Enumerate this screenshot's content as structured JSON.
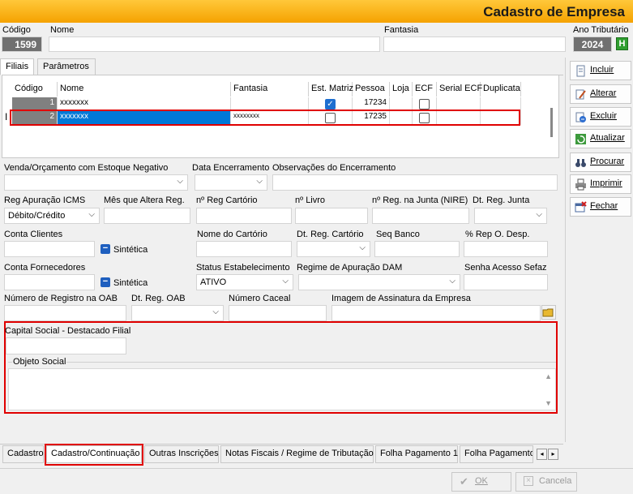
{
  "window": {
    "title": "Cadastro de Empresa"
  },
  "header": {
    "codigo_label": "Código",
    "codigo_value": "1599",
    "nome_label": "Nome",
    "fantasia_label": "Fantasia",
    "ano_label": "Ano Tributário",
    "ano_value": "2024",
    "ano_btn": "H"
  },
  "top_tabs": [
    "Filiais",
    "Parâmetros"
  ],
  "grid": {
    "columns": [
      "Código",
      "Nome",
      "Fantasia",
      "Est. Matriz",
      "Pessoa",
      "Loja",
      "ECF",
      "Serial ECF",
      "Duplicata"
    ],
    "rows": [
      {
        "codigo": "1",
        "nome": "xxxxxxx",
        "fantasia": "",
        "matriz": true,
        "pessoa": "17234",
        "ecf": false
      },
      {
        "codigo": "2",
        "nome": "xxxxxxx",
        "fantasia": "xxxxxxxx",
        "matriz": false,
        "pessoa": "17235",
        "ecf": false
      }
    ],
    "row_marker": "I"
  },
  "form": {
    "venda_label": "Venda/Orçamento com Estoque Negativo",
    "data_enc_label": "Data Encerramento",
    "obs_enc_label": "Observações do Encerramento",
    "reg_icms_label": "Reg Apuração ICMS",
    "reg_icms_value": "Débito/Crédito",
    "mes_label": "Mês que Altera Reg.",
    "nreg_cart_label": "nº Reg Cartório",
    "nlivro_label": "nº Livro",
    "nreg_junta_label": "nº Reg. na Junta (NIRE)",
    "dt_junta_label": "Dt. Reg. Junta",
    "conta_cli_label": "Conta Clientes",
    "sintetica1": "Sintética",
    "nome_cart_label": "Nome do Cartório",
    "dt_cart_label": "Dt. Reg. Cartório",
    "seq_banco_label": "Seq Banco",
    "rep_label": "% Rep O. Desp.",
    "conta_forn_label": "Conta Fornecedores",
    "sintetica2": "Sintética",
    "status_label": "Status Estabelecimento",
    "status_value": "ATIVO",
    "regime_dam_label": "Regime de Apuração DAM",
    "senha_label": "Senha Acesso Sefaz",
    "oab_label": "Número de Registro na OAB",
    "dt_oab_label": "Dt. Reg. OAB",
    "caceal_label": "Número Caceal",
    "assinatura_label": "Imagem de Assinatura da Empresa",
    "capital_label": "Capital Social - Destacado Filial",
    "objeto_label": "Objeto Social"
  },
  "side_buttons": [
    {
      "label": "Incluir",
      "icon": "document-icon"
    },
    {
      "label": "Alterar",
      "icon": "edit-icon"
    },
    {
      "label": "Excluir",
      "icon": "delete-icon"
    },
    {
      "label": "Atualizar",
      "icon": "refresh-icon"
    },
    {
      "label": "Procurar",
      "icon": "binoculars-icon"
    },
    {
      "label": "Imprimir",
      "icon": "printer-icon"
    },
    {
      "label": "Fechar",
      "icon": "close-window-icon"
    }
  ],
  "bottom_tabs": [
    "Cadastro",
    "Cadastro/Continuação",
    "Outras Inscrições",
    "Notas Fiscais / Regime de Tributação",
    "Folha Pagamento 1",
    "Folha Pagamento"
  ],
  "footer": {
    "ok": "OK",
    "cancel": "Cancela"
  },
  "colors": {
    "title_bar": "#f5a200",
    "selection": "#0078d7",
    "highlight_box": "#e00000"
  }
}
